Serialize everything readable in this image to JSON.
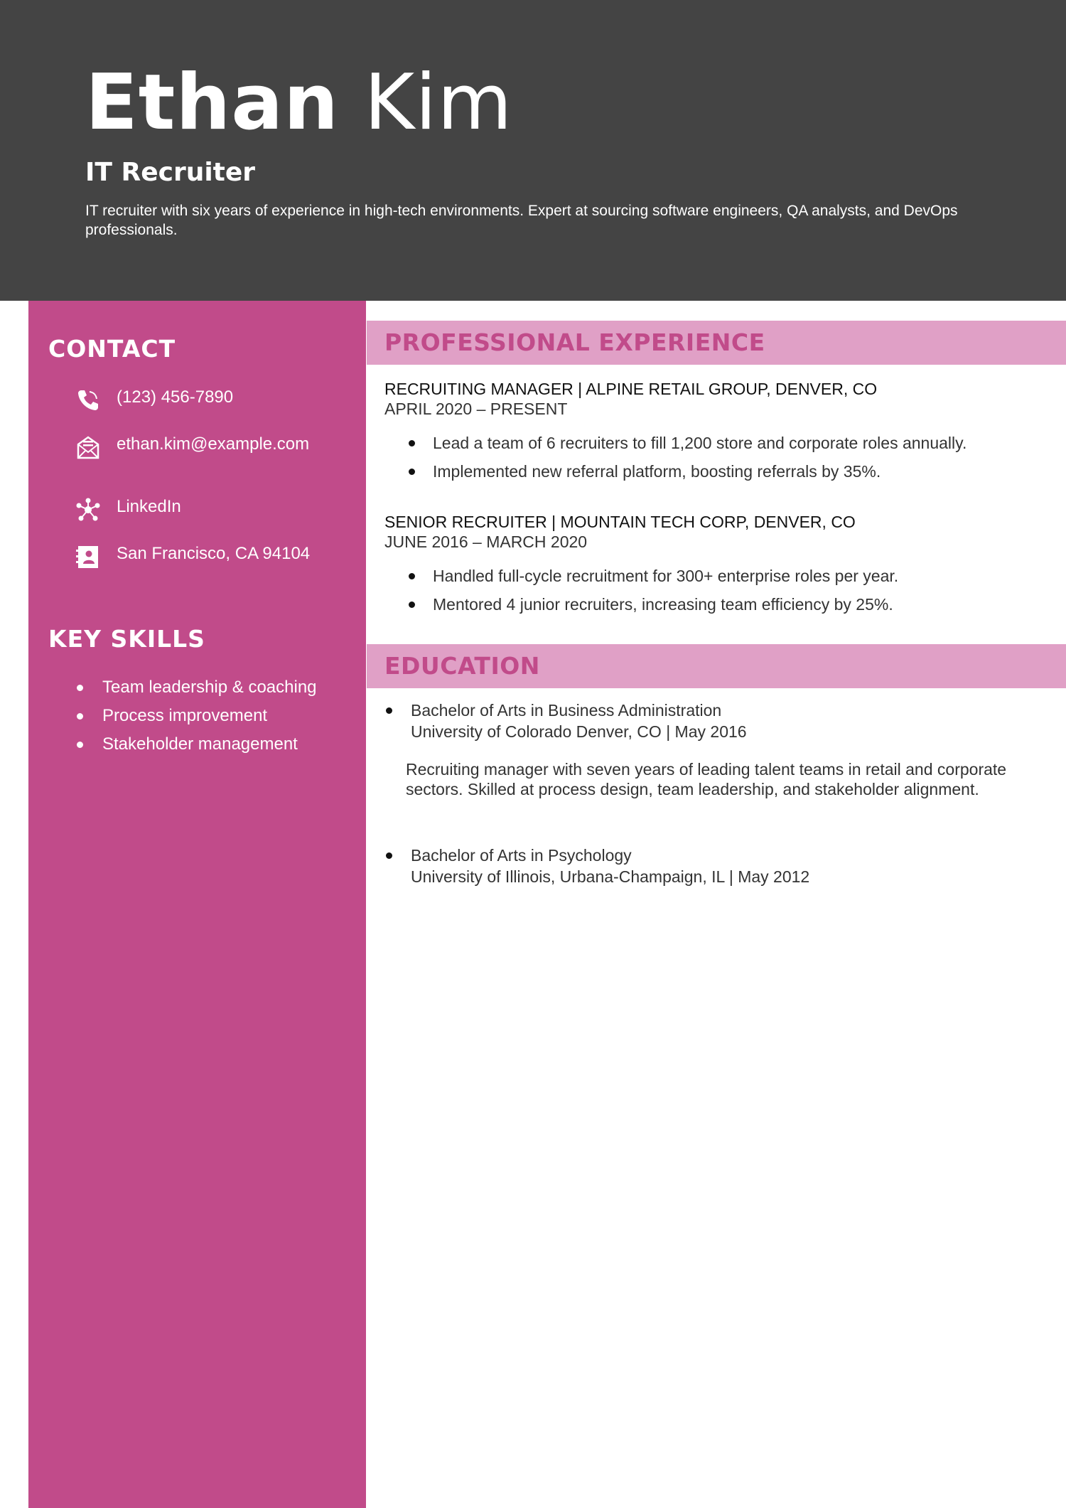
{
  "header": {
    "first_name": "Ethan",
    "last_name": "Kim",
    "title": "IT Recruiter",
    "summary": "IT recruiter with six years of experience in high-tech environments. Expert at sourcing software engineers, QA analysts, and DevOps professionals."
  },
  "sidebar": {
    "contact_heading": "CONTACT",
    "contact": [
      {
        "icon": "phone-icon",
        "text": "(123) 456-7890"
      },
      {
        "icon": "email-icon",
        "text": "ethan.kim@example.com"
      },
      {
        "icon": "network-icon",
        "text": "LinkedIn"
      },
      {
        "icon": "address-card-icon",
        "text": "San Francisco, CA 94104"
      }
    ],
    "skills_heading": "KEY SKILLS",
    "skills": [
      "Team leadership & coaching",
      "Process improvement",
      "Stakeholder management"
    ]
  },
  "experience": {
    "heading": "PROFESSIONAL EXPERIENCE",
    "jobs": [
      {
        "role": "RECRUITING MANAGER | ALPINE RETAIL GROUP, DENVER, CO",
        "dates": "APRIL 2020 – PRESENT",
        "bullets": [
          "Lead a team of 6 recruiters to fill 1,200 store and corporate roles annually.",
          "Implemented new referral platform, boosting referrals by 35%."
        ]
      },
      {
        "role": "SENIOR RECRUITER | MOUNTAIN TECH CORP, DENVER, CO",
        "dates": "JUNE 2016 – MARCH 2020",
        "bullets": [
          "Handled full-cycle recruitment for 300+ enterprise roles per year.",
          "Mentored 4 junior recruiters, increasing team efficiency by 25%."
        ]
      }
    ]
  },
  "education": {
    "heading": "EDUCATION",
    "entries": [
      {
        "degree": "Bachelor of Arts in Business Administration",
        "school": "University of Colorado Denver, CO | May 2016"
      },
      {
        "degree": "Bachelor of Arts in Psychology",
        "school": "University of Illinois, Urbana-Champaign, IL | May 2012"
      }
    ],
    "description": "Recruiting manager with seven years of leading talent teams in retail and corporate sectors. Skilled at process design, team leadership, and stakeholder alignment."
  },
  "colors": {
    "header_bg": "#444444",
    "sidebar_bg": "#c14b8a",
    "section_bar_bg": "#e0a0c6",
    "accent": "#c14b8a"
  }
}
